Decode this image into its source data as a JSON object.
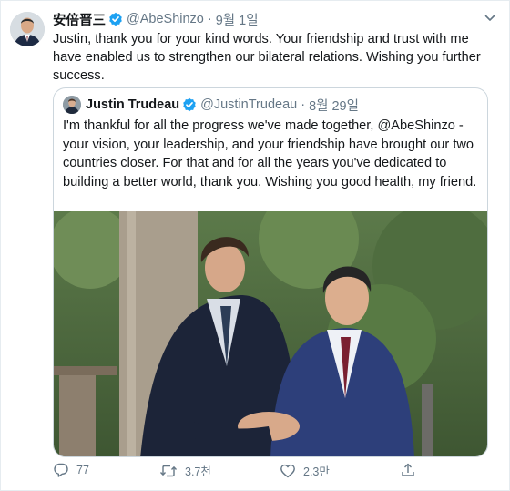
{
  "tweet": {
    "author_name": "安倍晋三",
    "handle": "@AbeShinzo",
    "separator": "·",
    "date": "9월 1일",
    "text": "Justin, thank you for your kind words. Your friendship and trust with me have enabled us to strengthen our bilateral relations. Wishing you further success."
  },
  "quoted": {
    "author_name": "Justin Trudeau",
    "handle": "@JustinTrudeau",
    "separator": "·",
    "date": "8월 29일",
    "text": "I'm thankful for all the progress we've made together, @AbeShinzo - your vision, your leadership, and your friendship have brought our two countries closer. For that and for all the years you've dedicated to building a better world, thank you. Wishing you good health, my friend."
  },
  "actions": {
    "reply_count": "77",
    "retweet_count": "3.7천",
    "like_count": "2.3만"
  },
  "icons": {
    "verified": "verified-badge-icon",
    "more": "chevron-down-icon",
    "reply": "reply-icon",
    "retweet": "retweet-icon",
    "like": "heart-icon",
    "share": "share-icon"
  },
  "colors": {
    "verified": "#1da1f2",
    "secondary_text": "#657786",
    "border": "#ccd6dd"
  }
}
